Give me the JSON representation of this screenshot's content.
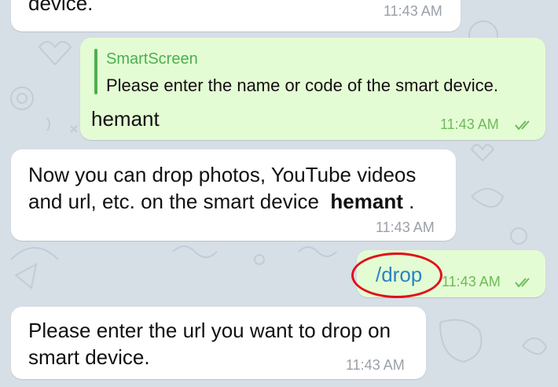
{
  "colors": {
    "chat_background": "#d6dee6",
    "incoming_bubble": "#ffffff",
    "outgoing_bubble": "#e4fcd4",
    "reply_accent": "#4caf50",
    "time_incoming": "#9aa0a6",
    "time_outgoing": "#6cbb5a",
    "command_link": "#2a83c4",
    "highlight_circle": "#e0101a"
  },
  "messages": [
    {
      "id": "msg-1",
      "direction": "incoming",
      "text": "device.",
      "time": "11:43 AM"
    },
    {
      "id": "msg-2",
      "direction": "outgoing",
      "reply": {
        "name": "SmartScreen",
        "text": "Please enter the name or code of the smart device."
      },
      "text": "hemant",
      "time": "11:43 AM",
      "status_icon": "double-check-icon"
    },
    {
      "id": "msg-3",
      "direction": "incoming",
      "line1": "Now you can drop photos, YouTube videos",
      "line2_prefix": "and url, etc. on the smart device",
      "line2_bold": "hemant",
      "line2_suffix": ".",
      "time": "11:43 AM"
    },
    {
      "id": "msg-4",
      "direction": "outgoing",
      "command": "/drop",
      "time": "11:43 AM",
      "status_icon": "double-check-icon"
    },
    {
      "id": "msg-5",
      "direction": "incoming",
      "line1": "Please enter the url you want to drop on",
      "line2": "smart device.",
      "time": "11:43 AM"
    }
  ]
}
